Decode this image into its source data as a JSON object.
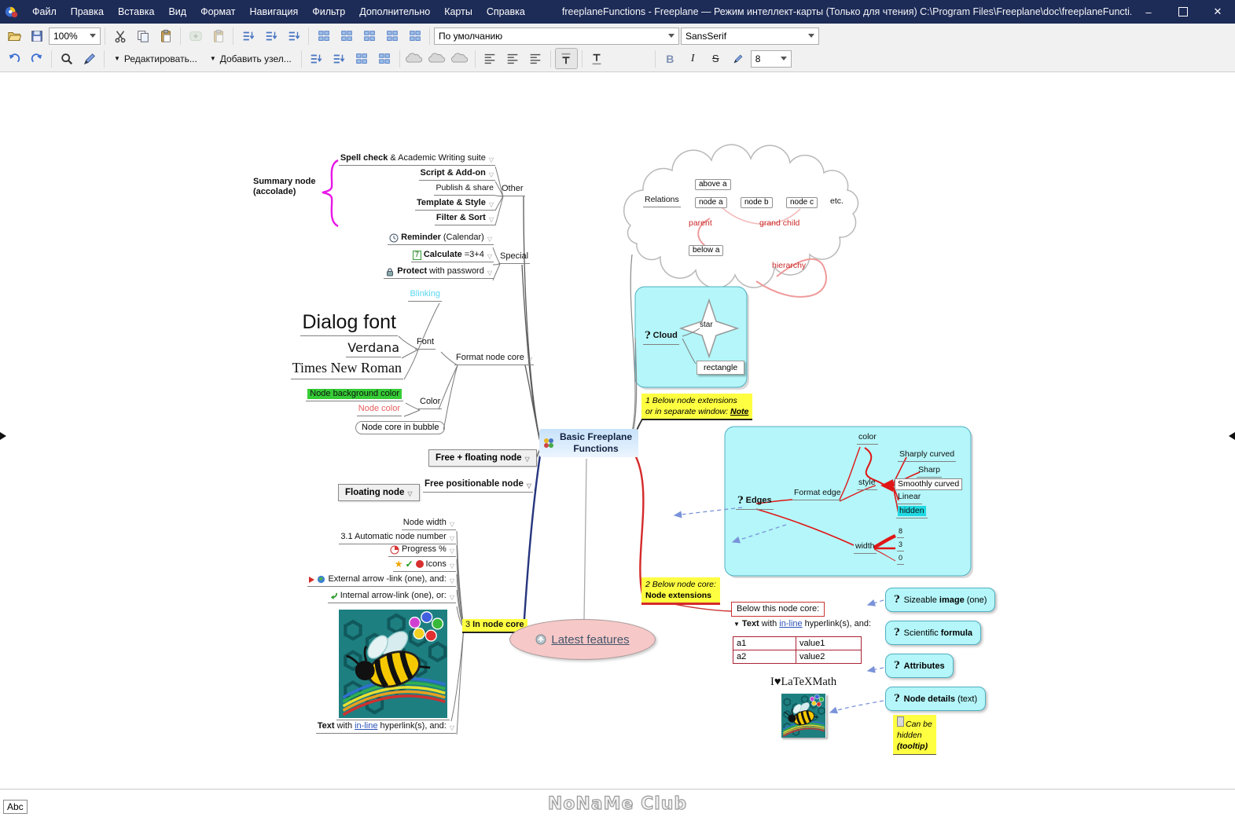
{
  "titlebar": {
    "title": "freeplaneFunctions - Freeplane — Режим интеллект-карты (Только для чтения)  C:\\Program Files\\Freeplane\\doc\\freeplaneFuncti...",
    "menus": [
      "Файл",
      "Правка",
      "Вставка",
      "Вид",
      "Формат",
      "Навигация",
      "Фильтр",
      "Дополнительно",
      "Карты",
      "Справка"
    ]
  },
  "toolbar": {
    "zoom": "100%",
    "style_combo": "По умолчанию",
    "font_combo": "SansSerif",
    "font_size": "8",
    "edit_button": "Редактировать...",
    "add_node_button": "Добавить узел...",
    "bold": "B",
    "italic": "I",
    "strike": "S"
  },
  "glyphs": {
    "fold": "▽",
    "menu_triangle": "▼",
    "question": "?",
    "star": "★",
    "check": "✓",
    "minimize": "–",
    "close": "✕"
  },
  "map": {
    "center_line1": "Basic Freeplane",
    "center_line2": "Functions",
    "summary_line1": "Summary node",
    "summary_line2": "(accolade)",
    "spell_b": "Spell check",
    "spell_r": " & Academic Writing suite",
    "script": "Script & Add-on",
    "publish": "Publish & share",
    "template": "Template & Style",
    "filter": "Filter & Sort",
    "other": "Other",
    "special": "Special",
    "reminder_b": "Reminder",
    "reminder_r": " (Calendar)",
    "calc_badge": "7",
    "calc_b": "Calculate",
    "calc_r": " =3+4",
    "protect_b": "Protect",
    "protect_r": " with password",
    "blinking": "Blinking",
    "dialog_font": "Dialog font",
    "verdana": "Verdana",
    "times": "Times New Roman",
    "font": "Font",
    "color": "Color",
    "node_bg": "Node background color",
    "node_color": "Node color",
    "bubble": "Node core in bubble",
    "format_core": "Format node core",
    "free_floating": "Free + floating node",
    "floating": "Floating node",
    "free_positionable": "Free positionable node",
    "node_width": "Node width",
    "auto_number": "3.1 Automatic node number",
    "progress": "Progress %",
    "icons": "Icons",
    "external": "External arrow -link (one), and:",
    "internal": "Internal arrow-link (one), or:",
    "text_b": "Text",
    "text_mid": " with ",
    "text_link": "in-line",
    "text_rest": " hyperlink(s), and:",
    "inc_pre": "3 ",
    "inc_b": "In node core",
    "latest": "Latest features",
    "relations": "Relations",
    "above_a": "above a",
    "node_a": "node a",
    "node_b": "node b",
    "node_c": "node c",
    "etc": "etc.",
    "parent": "parent",
    "grand_child": "grand child",
    "below_a": "below a",
    "hierarchy": "hierarchy",
    "cloud": "Cloud",
    "star_label": "star",
    "rectangle": "rectangle",
    "note1_l1": "1 Below node extensions",
    "note1_l2a": "or in separate window: ",
    "note1_l2b": "Note",
    "edges": "Edges",
    "edge_color": "color",
    "edge_style": "style",
    "format_edge": "Format edge",
    "sharply": "Sharply curved",
    "sharp": "Sharp",
    "smoothly": "Smoothly curved",
    "linear": "Linear",
    "hidden": "hidden",
    "width": "width",
    "w8": "8",
    "w3": "3",
    "w0": "0",
    "note2_l1": "2 Below node core:",
    "note2_l2": "Node extensions",
    "below_core": "Below  this node core:",
    "table_a1": "a1",
    "table_v1": "value1",
    "table_a2": "a2",
    "table_v2": "value2",
    "latex": "I♥LaTeXMath",
    "sizeable_pre": "Sizeable ",
    "sizeable_b": "image",
    "sizeable_post": " (one)",
    "sci_pre": "Scientific ",
    "sci_b": "formula",
    "attributes": "Attributes",
    "details_b": "Node details",
    "details_post": " (text)",
    "tt1": "Can be",
    "tt2": "hidden",
    "tt3": "(tooltip)"
  },
  "statusbar": {
    "abc": "Abc",
    "watermark": "NoNaMe Club"
  }
}
